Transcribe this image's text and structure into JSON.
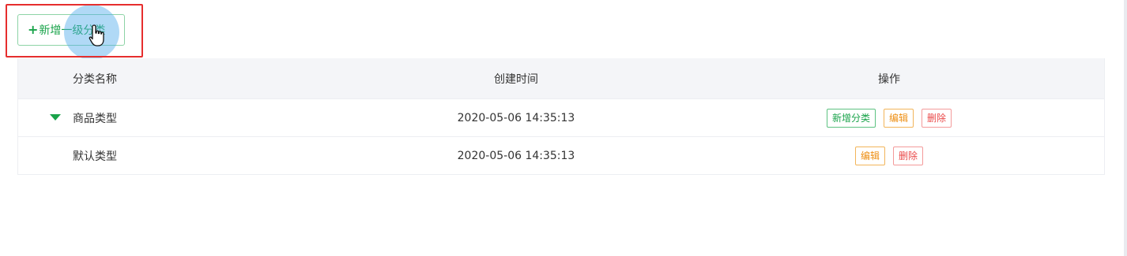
{
  "toolbar": {
    "add_top_category_label": "新增一级分类"
  },
  "table": {
    "headers": {
      "name": "分类名称",
      "created_at": "创建时间",
      "actions": "操作"
    },
    "rows": [
      {
        "name": "商品类型",
        "created_at": "2020-05-06 14:35:13",
        "expanded": true,
        "actions": [
          "新增分类",
          "编辑",
          "删除"
        ]
      },
      {
        "name": "默认类型",
        "created_at": "2020-05-06 14:35:13",
        "actions": [
          "编辑",
          "删除"
        ]
      }
    ]
  },
  "icons": {
    "expand": "caret-down-icon",
    "cursor": "hand-pointer-icon"
  },
  "colors": {
    "primary_green": "#19a34a",
    "warning_orange": "#ee8f14",
    "danger_red": "#ea4a4a",
    "highlight_red": "#e62e2e",
    "header_bg": "#f4f5f8"
  }
}
